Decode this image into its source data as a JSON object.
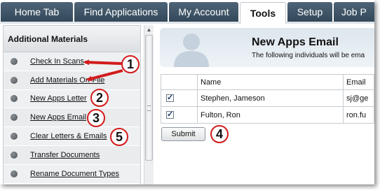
{
  "tabs": [
    {
      "label": "Home Tab",
      "active": false
    },
    {
      "label": "Find Applications",
      "active": false
    },
    {
      "label": "My Account",
      "active": false
    },
    {
      "label": "Tools",
      "active": true
    },
    {
      "label": "Setup",
      "active": false
    },
    {
      "label": "Job P",
      "active": false
    }
  ],
  "sidebar": {
    "title": "Additional Materials",
    "items": [
      {
        "label": "Check In Scans"
      },
      {
        "label": "Add Materials On-File"
      },
      {
        "label": "New Apps Letter"
      },
      {
        "label": "New Apps Email"
      },
      {
        "label": "Clear Letters & Emails"
      },
      {
        "label": "Transfer Documents"
      },
      {
        "label": "Rename Document Types"
      }
    ]
  },
  "main": {
    "title": "New Apps Email",
    "subtitle": "The following individuals will be ema",
    "table": {
      "columns": [
        "",
        "Name",
        "Email"
      ],
      "rows": [
        {
          "checked": true,
          "name": "Stephen, Jameson",
          "email": "sj@ge"
        },
        {
          "checked": true,
          "name": "Fulton, Ron",
          "email": "ron.fu"
        }
      ]
    },
    "submit_label": "Submit"
  },
  "annotations": {
    "color": "#d21b1b",
    "badges": [
      "1",
      "2",
      "3",
      "4",
      "5"
    ]
  },
  "colors": {
    "tab_bg": "#3f5567",
    "accent_red": "#d21b1b"
  }
}
